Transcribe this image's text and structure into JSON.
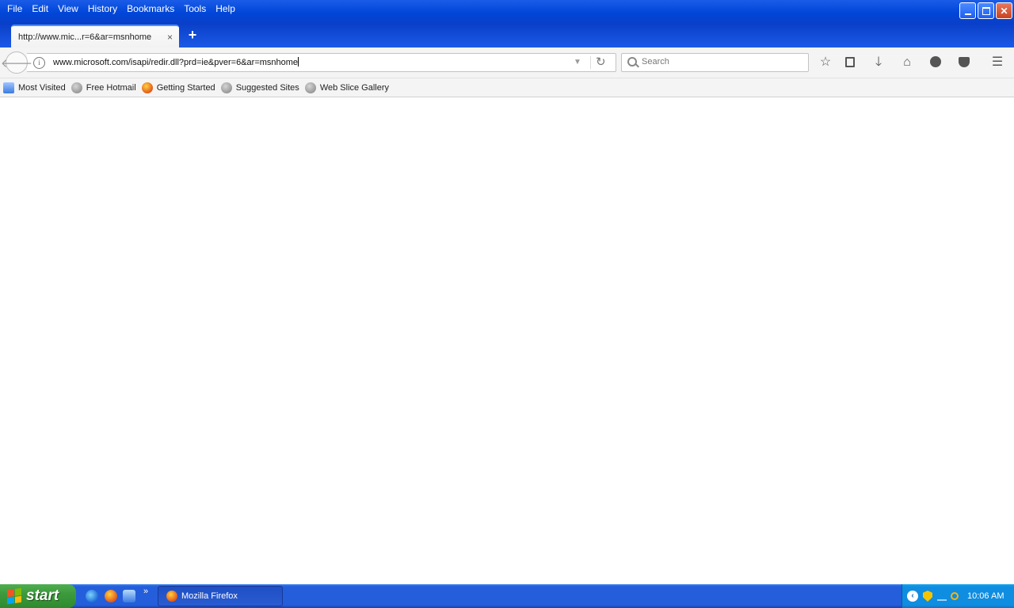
{
  "menubar": {
    "items": [
      "File",
      "Edit",
      "View",
      "History",
      "Bookmarks",
      "Tools",
      "Help"
    ]
  },
  "tab": {
    "title": "http://www.mic...r=6&ar=msnhome",
    "close_glyph": "×",
    "new_tab_glyph": "+"
  },
  "navbar": {
    "url": "www.microsoft.com/isapi/redir.dll?prd=ie&pver=6&ar=msnhome",
    "search_placeholder": "Search",
    "toolbar_icons": [
      "bookmark-star-icon",
      "reading-list-icon",
      "downloads-icon",
      "home-icon",
      "hello-icon",
      "pocket-icon",
      "hamburger-menu-icon"
    ]
  },
  "bookmarks": {
    "items": [
      {
        "label": "Most Visited",
        "icon": "folder-icon"
      },
      {
        "label": "Free Hotmail",
        "icon": "globe-icon"
      },
      {
        "label": "Getting Started",
        "icon": "firefox-icon"
      },
      {
        "label": "Suggested Sites",
        "icon": "globe-icon"
      },
      {
        "label": "Web Slice Gallery",
        "icon": "globe-icon"
      }
    ]
  },
  "taskbar": {
    "start_label": "start",
    "task_label": "Mozilla Firefox",
    "more_glyph": "»",
    "clock": "10:06 AM"
  },
  "colors": {
    "titlebar_blue": "#0046d8",
    "taskbar_blue": "#245edb",
    "start_green": "#3c9a3c",
    "tray_blue": "#0f8de0"
  }
}
